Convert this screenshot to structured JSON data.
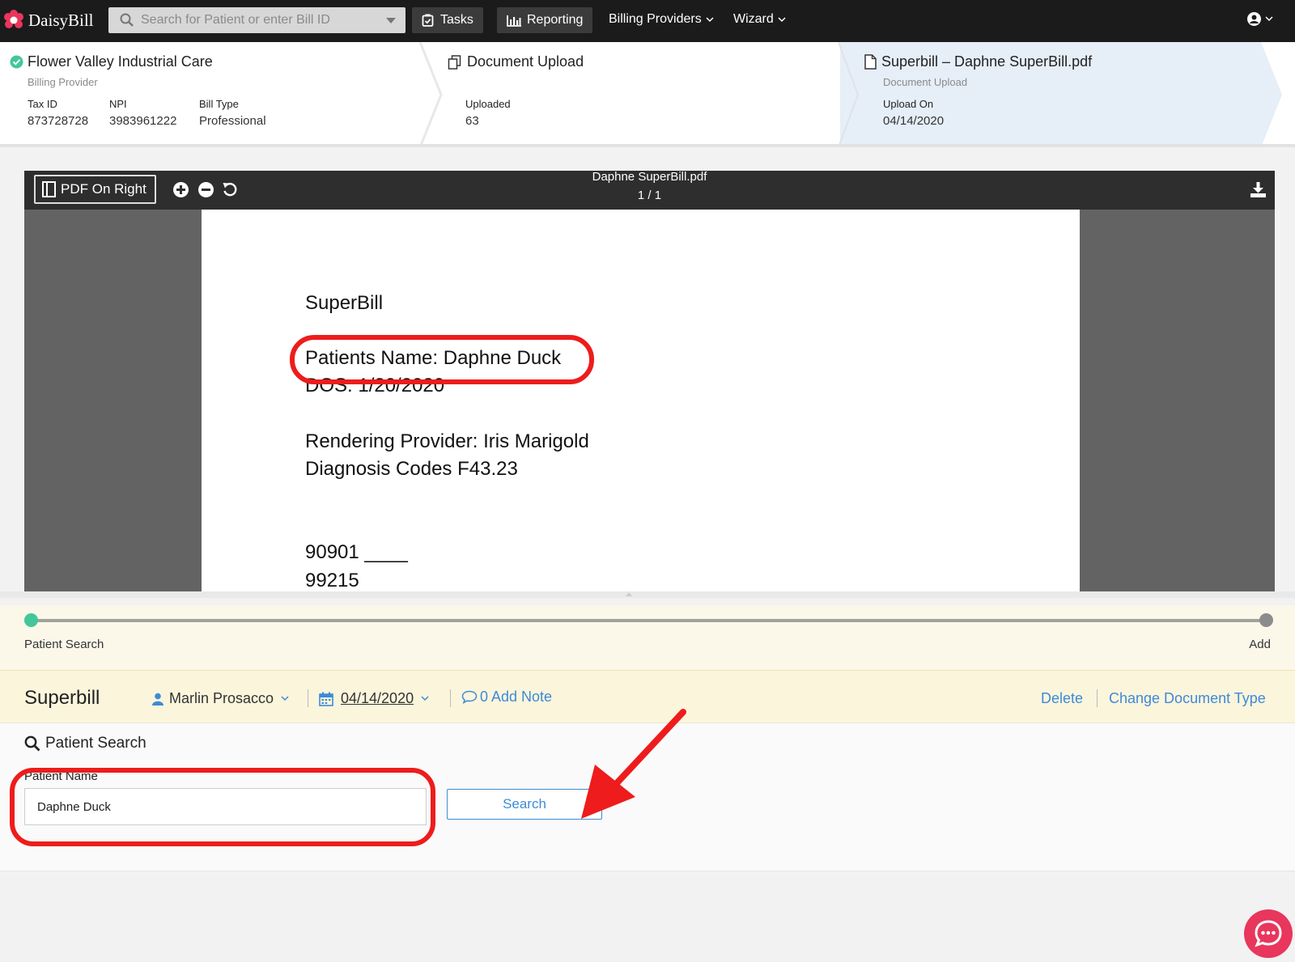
{
  "app": {
    "name": "DaisyBill"
  },
  "nav": {
    "search_placeholder": "Search for Patient or enter Bill ID",
    "tasks": "Tasks",
    "reporting": "Reporting",
    "billing_providers": "Billing Providers",
    "wizard": "Wizard"
  },
  "breadcrumb": {
    "provider": {
      "title": "Flower Valley Industrial Care",
      "subtitle": "Billing Provider",
      "fields": [
        {
          "label": "Tax ID",
          "value": "873728728"
        },
        {
          "label": "NPI",
          "value": "3983961222"
        },
        {
          "label": "Bill Type",
          "value": "Professional"
        }
      ]
    },
    "upload": {
      "title": "Document Upload",
      "field": {
        "label": "Uploaded",
        "value": "63"
      }
    },
    "document": {
      "title": "Superbill – Daphne SuperBill.pdf",
      "subtitle": "Document Upload",
      "field": {
        "label": "Upload On",
        "value": "04/14/2020"
      }
    }
  },
  "viewer": {
    "layout_button": "PDF On Right",
    "filename": "Daphne SuperBill.pdf",
    "page_indicator": "1 / 1",
    "page_lines": [
      "SuperBill",
      "Patients Name: Daphne Duck",
      "DOS: 1/20/2020",
      "Rendering Provider: Iris Marigold",
      "Diagnosis Codes F43.23",
      "90901 ____",
      "99215"
    ]
  },
  "progress": {
    "steps": [
      "Patient Search",
      "Add"
    ],
    "current_step": 1,
    "colors": {
      "active": "#43c79a",
      "inactive": "#8a8d8b"
    }
  },
  "superbill": {
    "title": "Superbill",
    "assignee": "Marlin Prosacco",
    "date": "04/14/2020",
    "note": "0 Add Note",
    "delete": "Delete",
    "change_type": "Change Document Type"
  },
  "patient_search": {
    "title": "Patient Search",
    "field_label": "Patient Name",
    "field_value": "Daphne Duck",
    "button": "Search"
  },
  "colors": {
    "accent": "#3e8ad8",
    "highlight": "#ee1c1c",
    "chat": "#e8365d"
  }
}
